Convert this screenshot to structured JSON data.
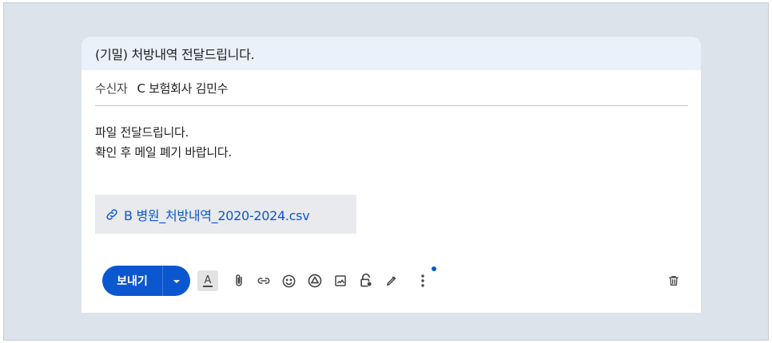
{
  "compose": {
    "subject": "(기밀) 처방내역 전달드립니다.",
    "recipient_label": "수신자",
    "recipient_value": "C 보험회사 김민수",
    "body_lines": [
      "파일 전달드립니다.",
      "확인 후 메일 폐기 바랍니다."
    ],
    "attachment": {
      "icon": "link-icon",
      "filename": "B 병원_처방내역_2020-2024.csv"
    }
  },
  "toolbar": {
    "send_label": "보내기",
    "send_options_icon": "caret-down-icon",
    "tools": [
      {
        "name": "text-format-icon",
        "glyph": "A"
      },
      {
        "name": "attach-file-icon"
      },
      {
        "name": "insert-link-icon"
      },
      {
        "name": "emoji-icon"
      },
      {
        "name": "drive-icon"
      },
      {
        "name": "insert-photo-icon"
      },
      {
        "name": "confidential-mode-icon"
      },
      {
        "name": "signature-icon"
      },
      {
        "name": "more-options-icon"
      }
    ],
    "delete_icon": "trash-icon"
  },
  "colors": {
    "accent": "#0b57d0",
    "subject_bg": "#eaf1fb",
    "frame_bg": "#dde3ea",
    "attachment_bg": "#e8eaed"
  }
}
